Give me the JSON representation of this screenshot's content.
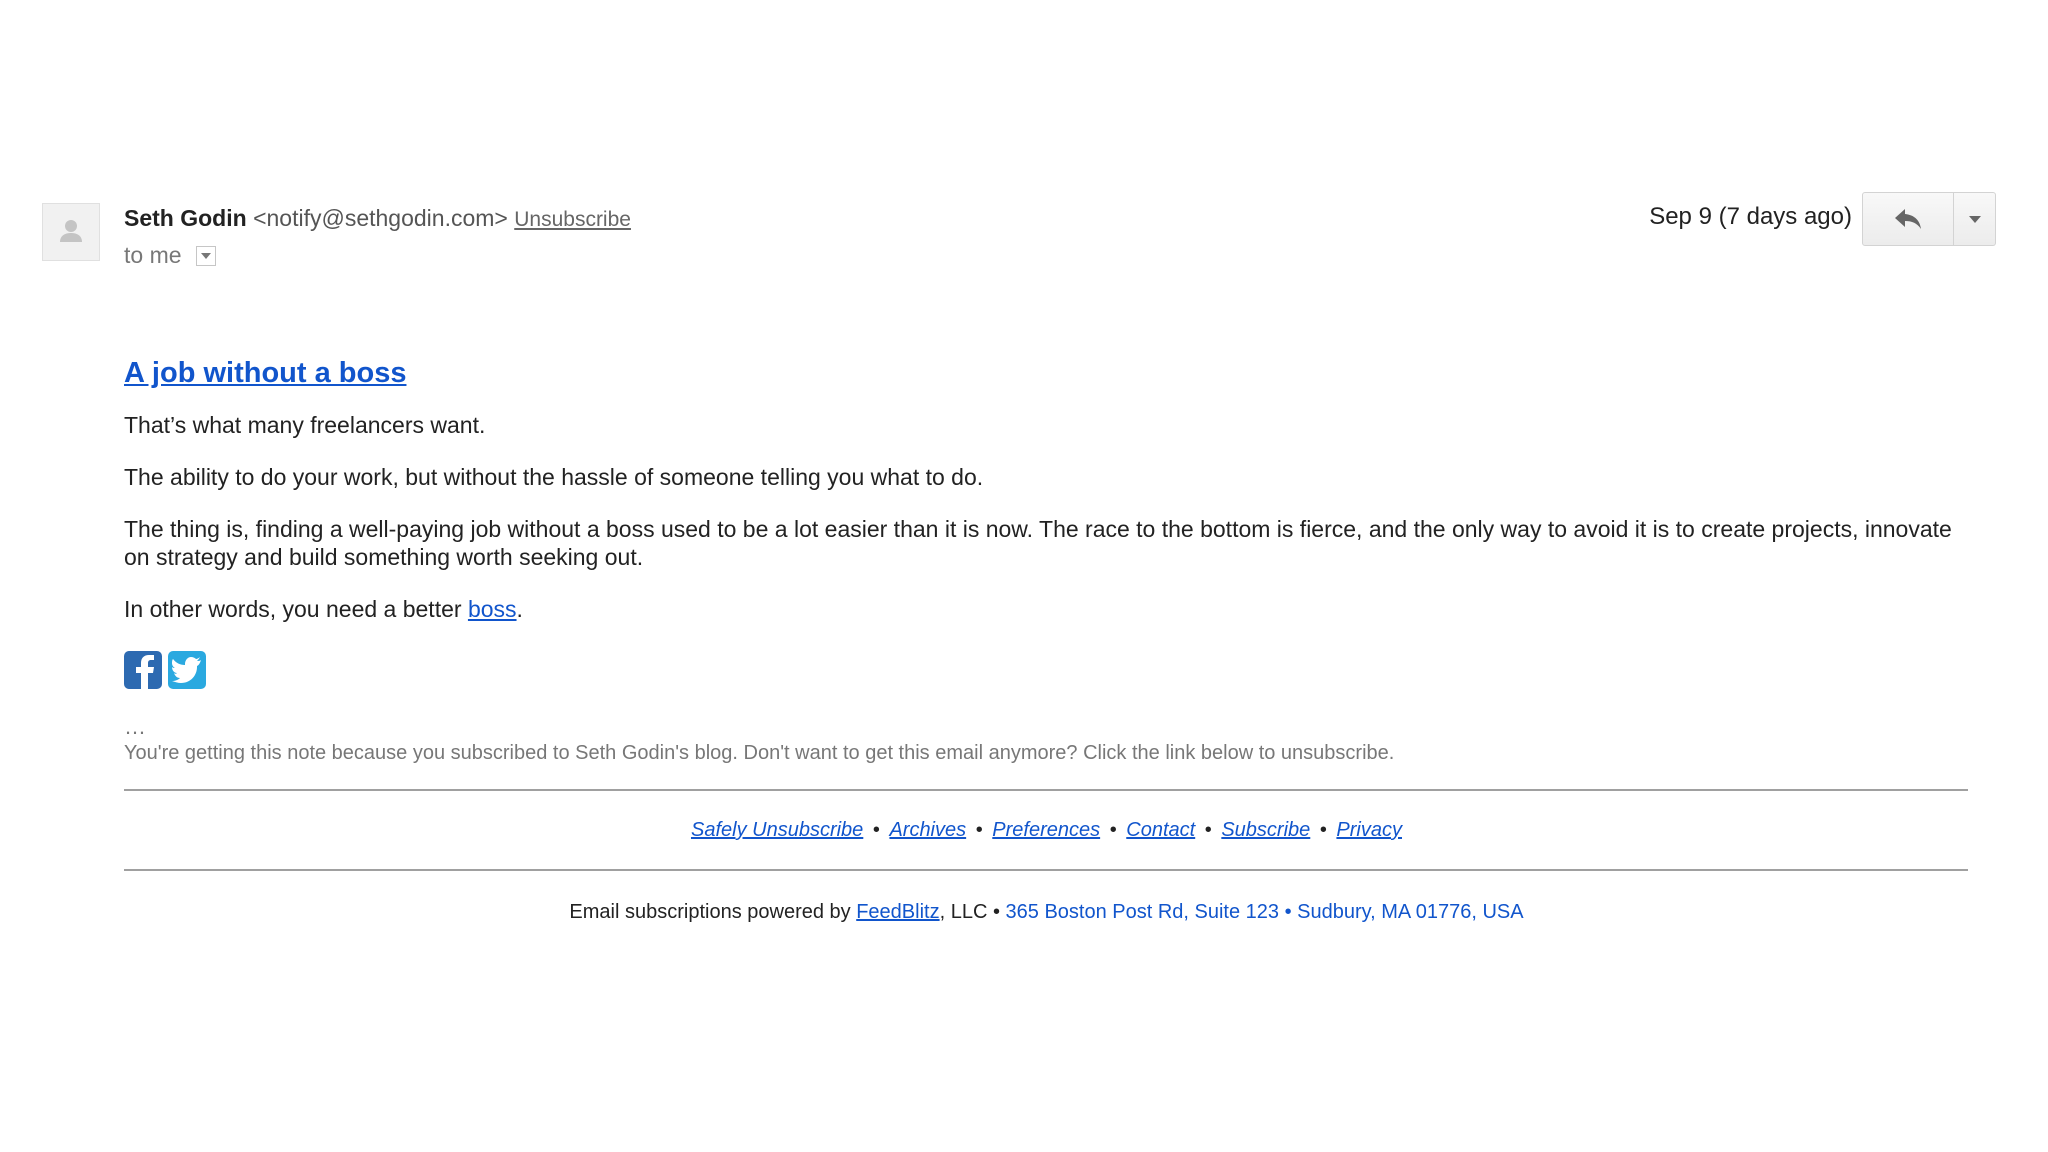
{
  "header": {
    "sender_name": "Seth Godin",
    "sender_email": "<notify@sethgodin.com>",
    "unsubscribe_label": "Unsubscribe",
    "recipient_label": "to me",
    "date_label": "Sep 9 (7 days ago)",
    "reply_icon": "reply-icon",
    "more_icon": "chevron-down-icon",
    "avatar_icon": "person-icon"
  },
  "body": {
    "title": "A job without a boss",
    "paragraph_1": "That’s what many freelancers want.",
    "paragraph_2": "The ability to do your work, but without the hassle of someone telling you what to do.",
    "paragraph_3": "The thing is, finding a well-paying job without a boss used to be a lot easier than it is now. The race to the bottom is fierce, and the only way to avoid it is to create projects, innovate on strategy and build something worth seeking out.",
    "paragraph_4_prefix": "In other words, you need a better ",
    "paragraph_4_link": "boss",
    "paragraph_4_suffix": ".",
    "social": [
      {
        "icon": "facebook-icon"
      },
      {
        "icon": "twitter-icon"
      }
    ]
  },
  "footer": {
    "ellipsis": "…",
    "note": "You're getting this note because you subscribed to Seth Godin's blog. Don't want to get this email anymore? Click the link below to unsubscribe.",
    "links": [
      "Safely Unsubscribe",
      "Archives",
      "Preferences",
      "Contact",
      "Subscribe",
      "Privacy"
    ],
    "separator": "•",
    "powered_prefix": "Email subscriptions powered by ",
    "powered_link": "FeedBlitz",
    "powered_suffix": ", LLC • ",
    "address": "365 Boston Post Rd, Suite 123 • Sudbury, MA 01776, USA"
  },
  "colors": {
    "link": "#1155cc",
    "facebook": "#2d6ab1",
    "twitter": "#2aa9e0"
  }
}
